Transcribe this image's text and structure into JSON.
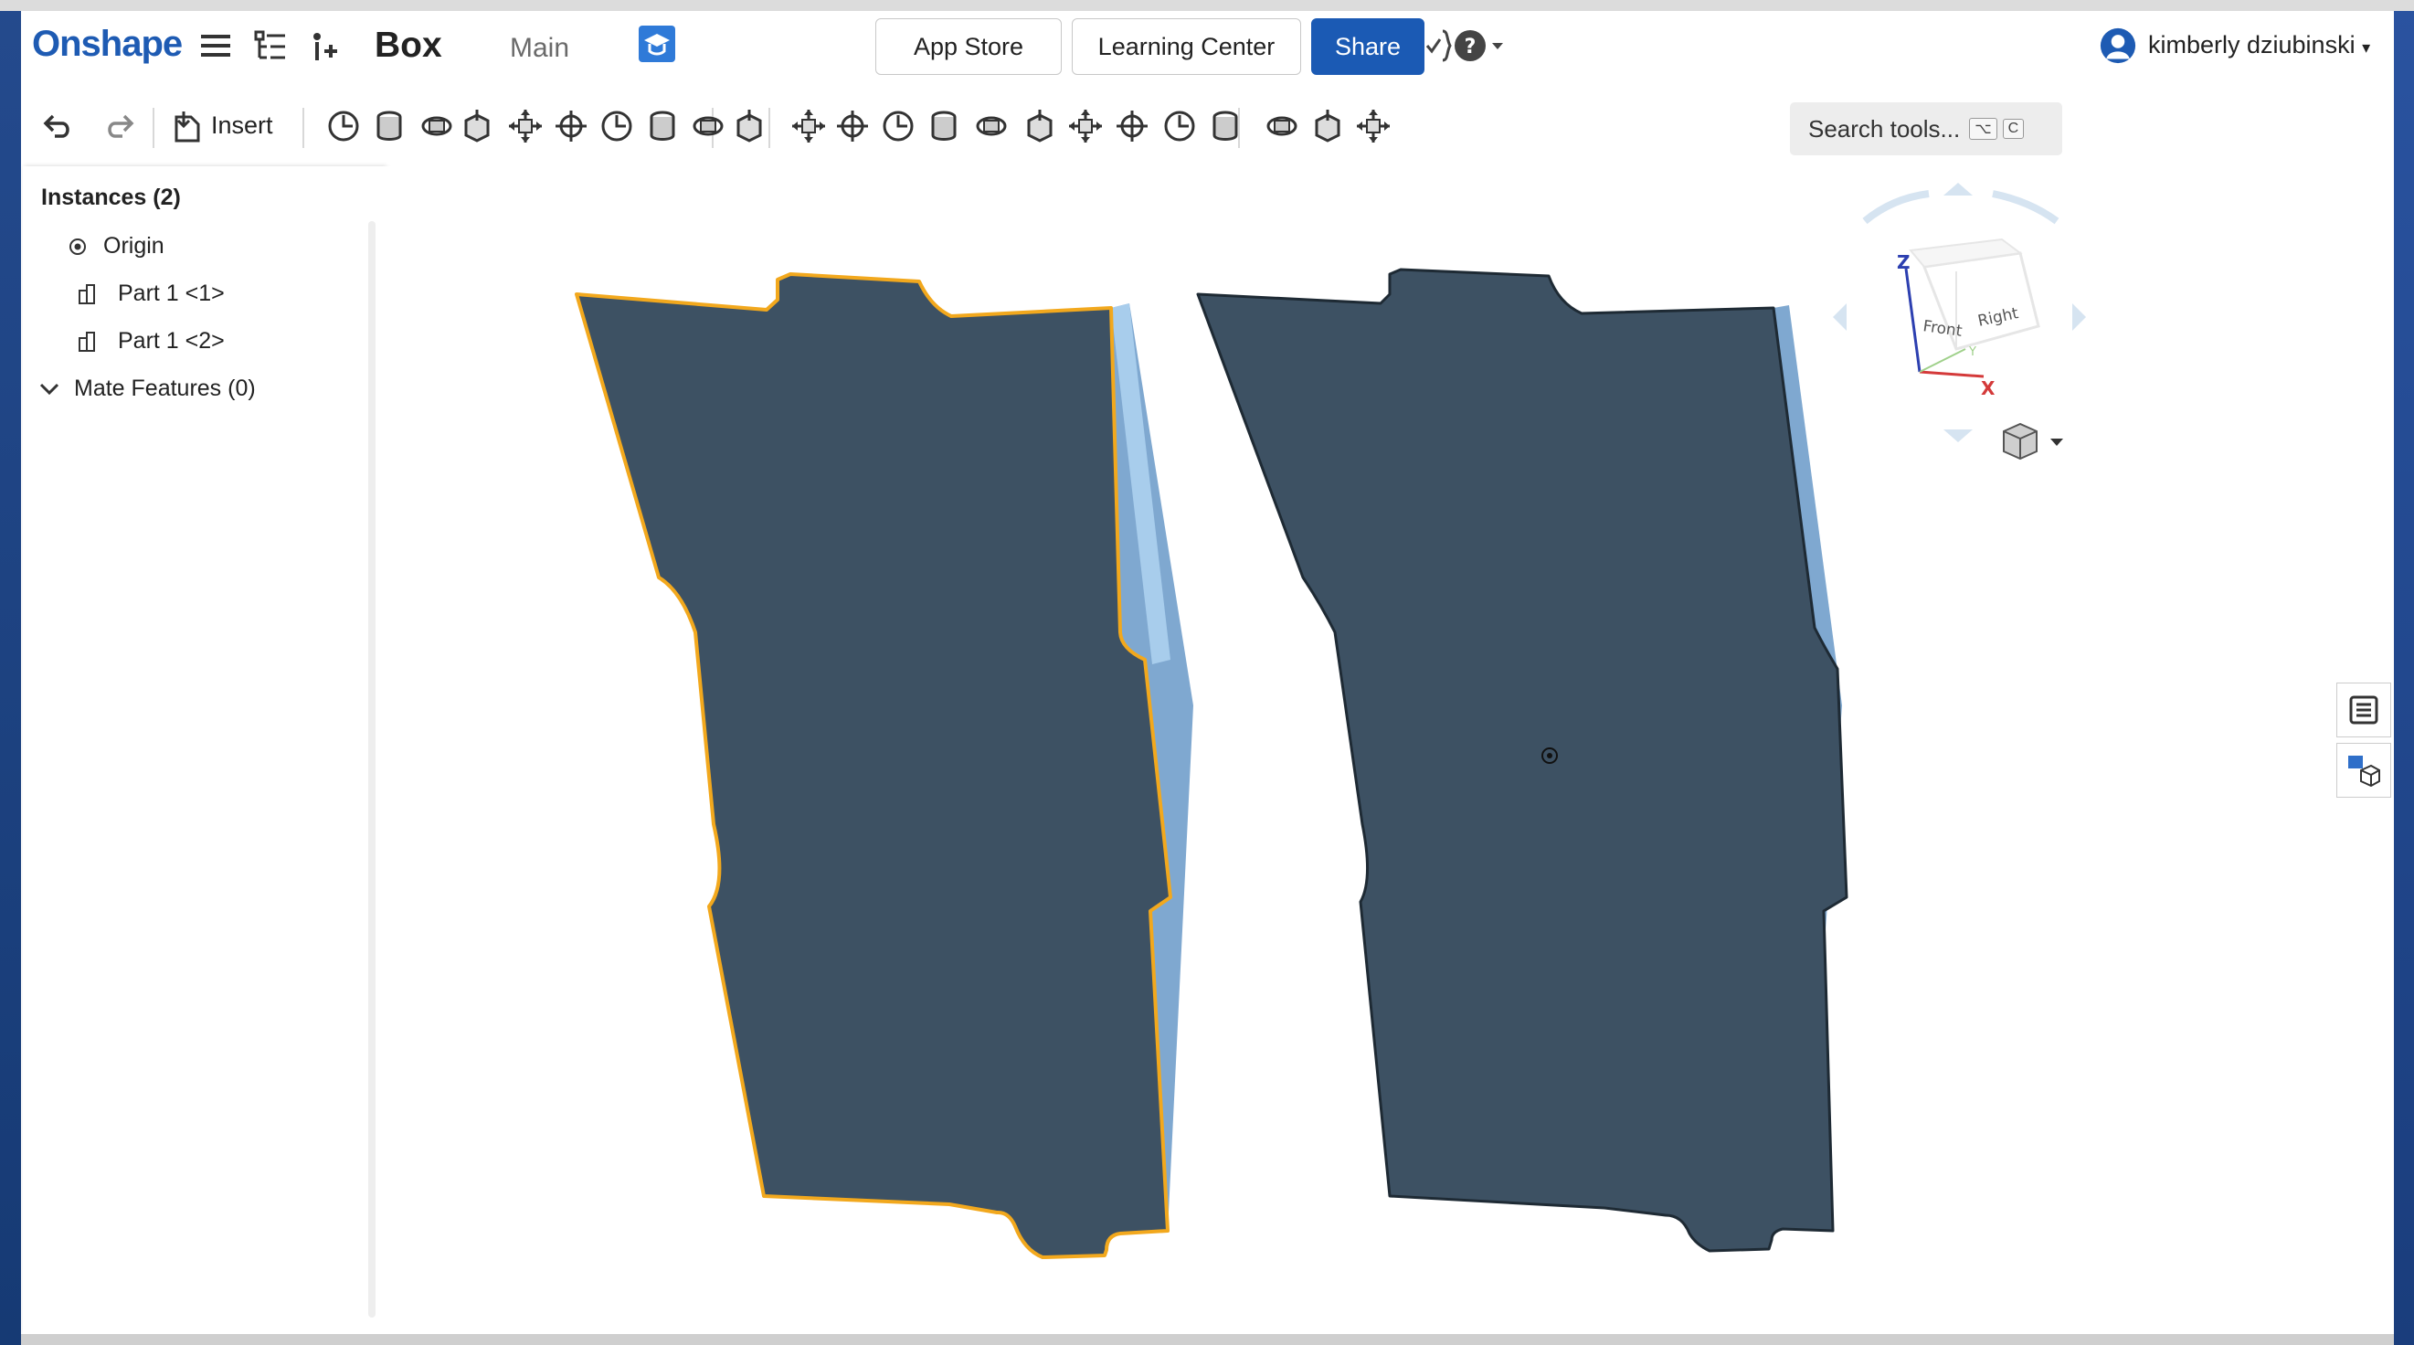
{
  "app": {
    "logo": "Onshape",
    "document_title": "Box",
    "workspace": "Main"
  },
  "topbar": {
    "app_store": "App Store",
    "learning_center": "Learning Center",
    "share": "Share",
    "user_name": "kimberly dziubinski"
  },
  "toolbar": {
    "insert_label": "Insert",
    "search_placeholder": "Search tools...",
    "search_shortcut_1": "⌥",
    "search_shortcut_2": "C"
  },
  "panel": {
    "heading": "Instances (2)",
    "items": [
      {
        "label": "Origin",
        "icon": "origin-icon"
      },
      {
        "label": "Part 1 <1>",
        "icon": "part-icon"
      },
      {
        "label": "Part 1 <2>",
        "icon": "part-icon"
      }
    ],
    "mate_features": "Mate Features (0)"
  },
  "viewcube": {
    "front": "Front",
    "right": "Right",
    "axis_x": "X",
    "axis_y": "Y",
    "axis_z": "Z"
  },
  "colors": {
    "brand": "#1e5bb3",
    "share_button": "#1b5ab4",
    "part_face": "#3d5163",
    "part_edge": "#7fa8d0",
    "selection": "#f2a81d"
  }
}
